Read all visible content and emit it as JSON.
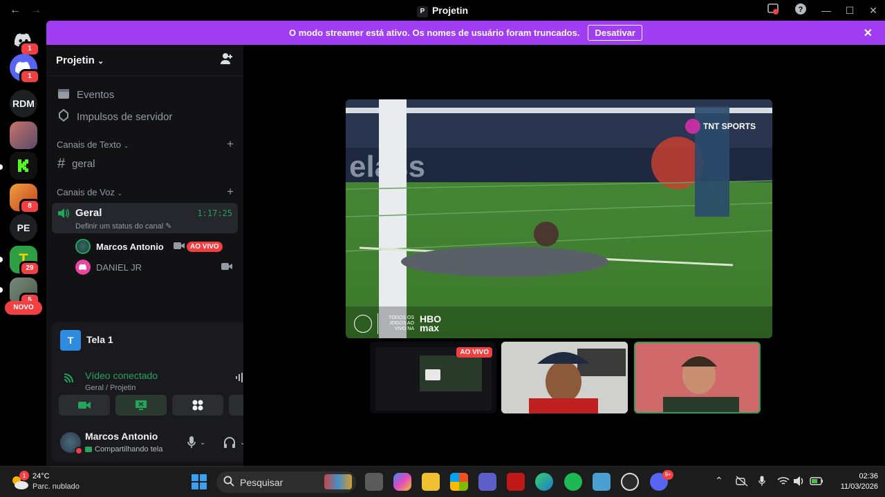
{
  "window": {
    "title": "Projetin",
    "title_icon": "P",
    "back": "←",
    "forward": "→"
  },
  "banner": {
    "message": "O modo streamer está ativo. Os nomes de usuário foram truncados.",
    "button": "Desativar"
  },
  "guilds": [
    {
      "badge": "1"
    },
    {
      "badge": "1"
    },
    {
      "label": "RDM"
    },
    {
      "label": ""
    },
    {
      "label": ""
    },
    {
      "badge": "8"
    },
    {
      "label": "PE"
    },
    {
      "badge": "29"
    },
    {
      "badge": "5"
    }
  ],
  "novo_label": "NOVO",
  "server": {
    "name": "Projetin",
    "events": "Eventos",
    "boosts": "Impulsos de servidor",
    "text_category": "Canais de Texto",
    "text_channel": "geral",
    "voice_category": "Canais de Voz",
    "voice_channel": "Geral",
    "voice_status": "Definir um status do canal",
    "voice_timer": "1:17:25",
    "members": [
      {
        "name": "Marcos Antonio",
        "live": "AO VIVO"
      },
      {
        "name": "DANIEL JR"
      }
    ]
  },
  "rtc": {
    "screen_label": "Tela 1",
    "screen_icon": "T",
    "status": "Vídeo conectado",
    "location": "Geral / Projetin"
  },
  "user": {
    "name": "Marcos Antonio",
    "status": "Compartilhando tela"
  },
  "stage": {
    "broadcaster": "TNT SPORTS",
    "bottom_text": "TODOS OS JOGOS AO VIVO NA",
    "hbo": "HBO",
    "max": "max",
    "thumb_live": "AO VIVO"
  },
  "taskbar": {
    "weather_temp": "24°C",
    "weather_desc": "Parc. nublado",
    "weather_badge": "1",
    "search": "Pesquisar",
    "discord_badge": "9+",
    "time": "02:36",
    "date": "11/03/2026"
  }
}
